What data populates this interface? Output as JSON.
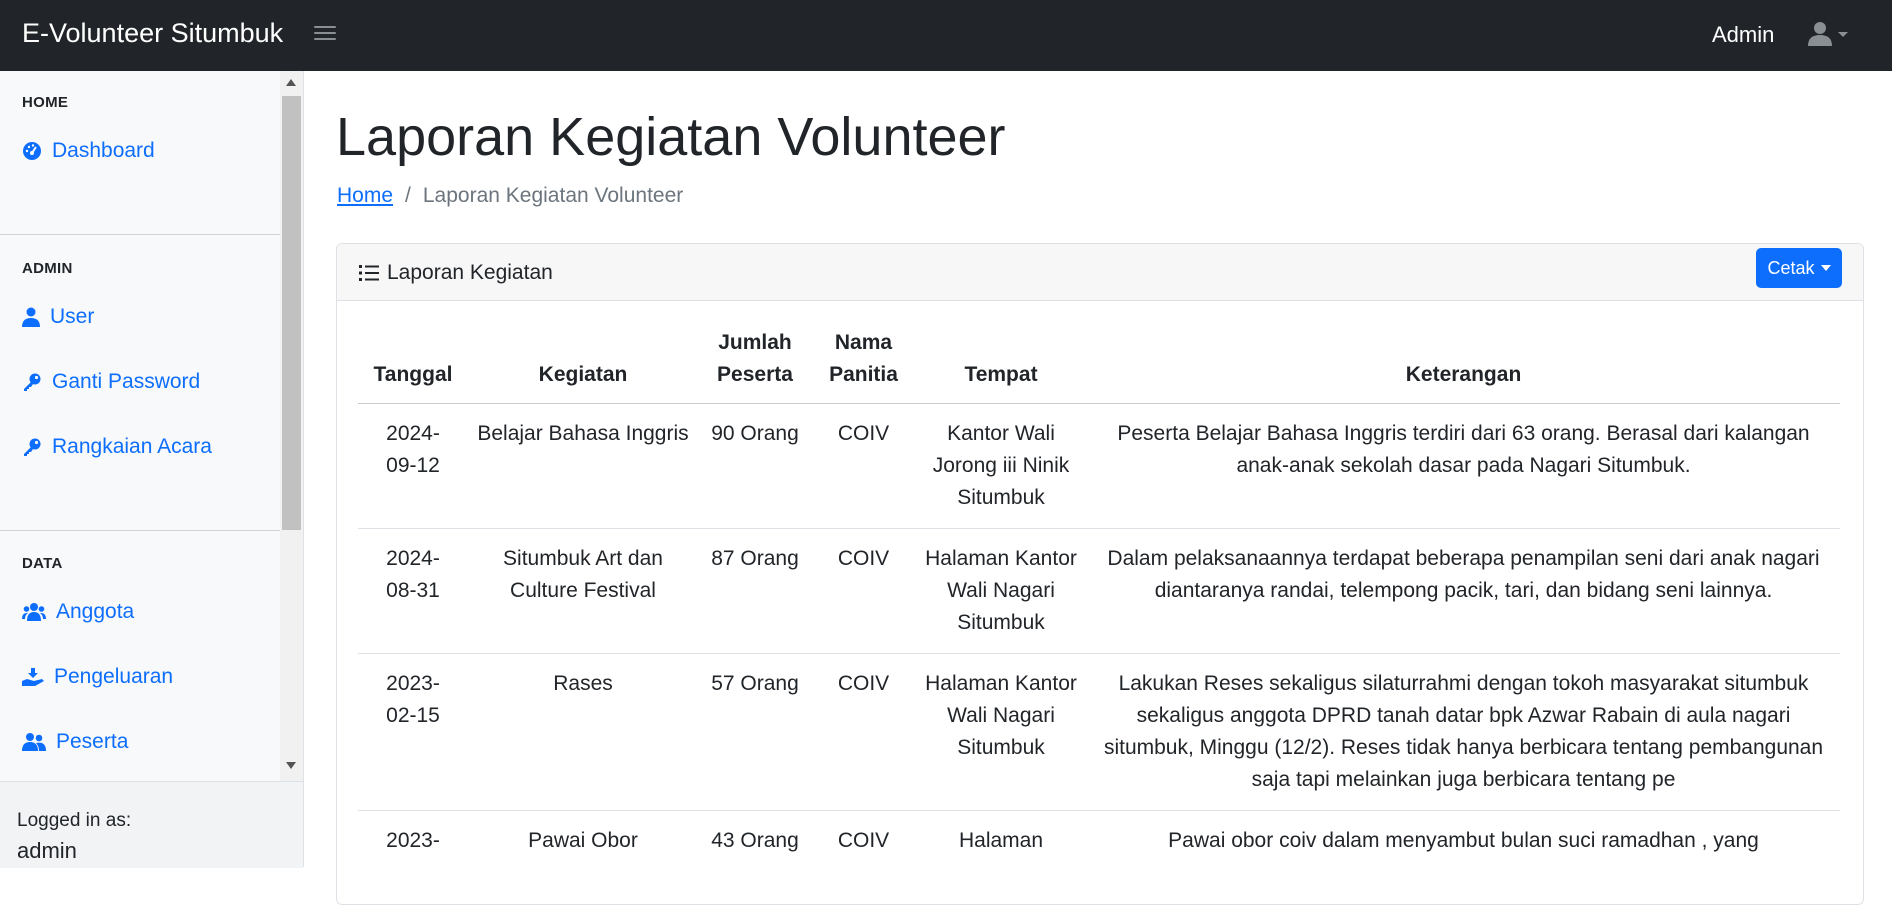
{
  "navbar": {
    "brand": "E-Volunteer Situmbuk",
    "user_label": "Admin"
  },
  "sidebar": {
    "headings": {
      "home": "HOME",
      "admin": "ADMIN",
      "data": "DATA"
    },
    "items": [
      {
        "label": "Dashboard",
        "icon": "dashboard-icon"
      },
      {
        "label": "User",
        "icon": "user-icon"
      },
      {
        "label": "Ganti Password",
        "icon": "key-icon"
      },
      {
        "label": "Rangkaian Acara",
        "icon": "key-icon"
      },
      {
        "label": "Anggota",
        "icon": "users-icon"
      },
      {
        "label": "Pengeluaran",
        "icon": "hand-coins-icon"
      },
      {
        "label": "Peserta",
        "icon": "users-icon"
      }
    ],
    "footer": {
      "label": "Logged in as:",
      "user": "admin"
    }
  },
  "page": {
    "title": "Laporan Kegiatan Volunteer",
    "breadcrumb": {
      "home": "Home",
      "separator": "/",
      "current": "Laporan Kegiatan Volunteer"
    }
  },
  "card": {
    "title": "Laporan Kegiatan",
    "button": "Cetak"
  },
  "table": {
    "headers": {
      "tanggal": "Tanggal",
      "kegiatan": "Kegiatan",
      "jumlah_line1": "Jumlah",
      "jumlah_line2": "Peserta",
      "panitia_line1": "Nama",
      "panitia_line2": "Panitia",
      "tempat": "Tempat",
      "keterangan": "Keterangan"
    },
    "rows": [
      {
        "tanggal_a": "2024-",
        "tanggal_b": "09-12",
        "kegiatan": "Belajar Bahasa Inggris",
        "jumlah": "90 Orang",
        "panitia": "COIV",
        "tempat": "Kantor Wali Jorong iii Ninik Situmbuk",
        "keterangan": "Peserta Belajar Bahasa Inggris terdiri dari 63 orang. Berasal dari kalangan anak-anak sekolah dasar pada Nagari Situmbuk."
      },
      {
        "tanggal_a": "2024-",
        "tanggal_b": "08-31",
        "kegiatan": "Situmbuk Art dan Culture Festival",
        "jumlah": "87 Orang",
        "panitia": "COIV",
        "tempat": "Halaman Kantor Wali Nagari Situmbuk",
        "keterangan": "Dalam pelaksanaannya terdapat beberapa penampilan seni dari anak nagari diantaranya randai, telempong pacik, tari, dan bidang seni lainnya."
      },
      {
        "tanggal_a": "2023-",
        "tanggal_b": "02-15",
        "kegiatan": "Rases",
        "jumlah": "57 Orang",
        "panitia": "COIV",
        "tempat": "Halaman Kantor Wali Nagari Situmbuk",
        "keterangan": "Lakukan Reses sekaligus silaturrahmi dengan tokoh masyarakat situmbuk sekaligus anggota DPRD tanah datar bpk Azwar Rabain di aula nagari situmbuk, Minggu (12/2). Reses tidak hanya berbicara tentang pembangunan saja tapi melainkan juga berbicara tentang pe"
      },
      {
        "tanggal_a": "2023-",
        "tanggal_b": "",
        "kegiatan": "Pawai Obor",
        "jumlah": "43 Orang",
        "panitia": "COIV",
        "tempat": "Halaman",
        "keterangan": "Pawai obor coiv dalam menyambut bulan suci ramadhan , yang"
      }
    ]
  }
}
